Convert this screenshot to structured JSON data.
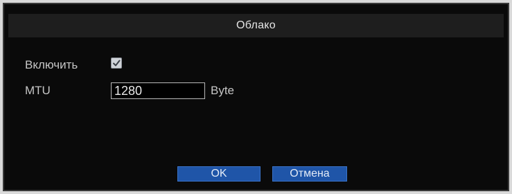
{
  "dialog": {
    "title": "Облако"
  },
  "form": {
    "enable_label": "Включить",
    "enable_checked": true,
    "mtu_label": "MTU",
    "mtu_value": "1280",
    "mtu_unit": "Byte"
  },
  "buttons": {
    "ok_label": "OK",
    "cancel_label": "Отмена"
  },
  "colors": {
    "button_bg": "#1f55a8",
    "dialog_bg": "#0a0a0a",
    "title_bar_bg": "#1e1e1e"
  }
}
